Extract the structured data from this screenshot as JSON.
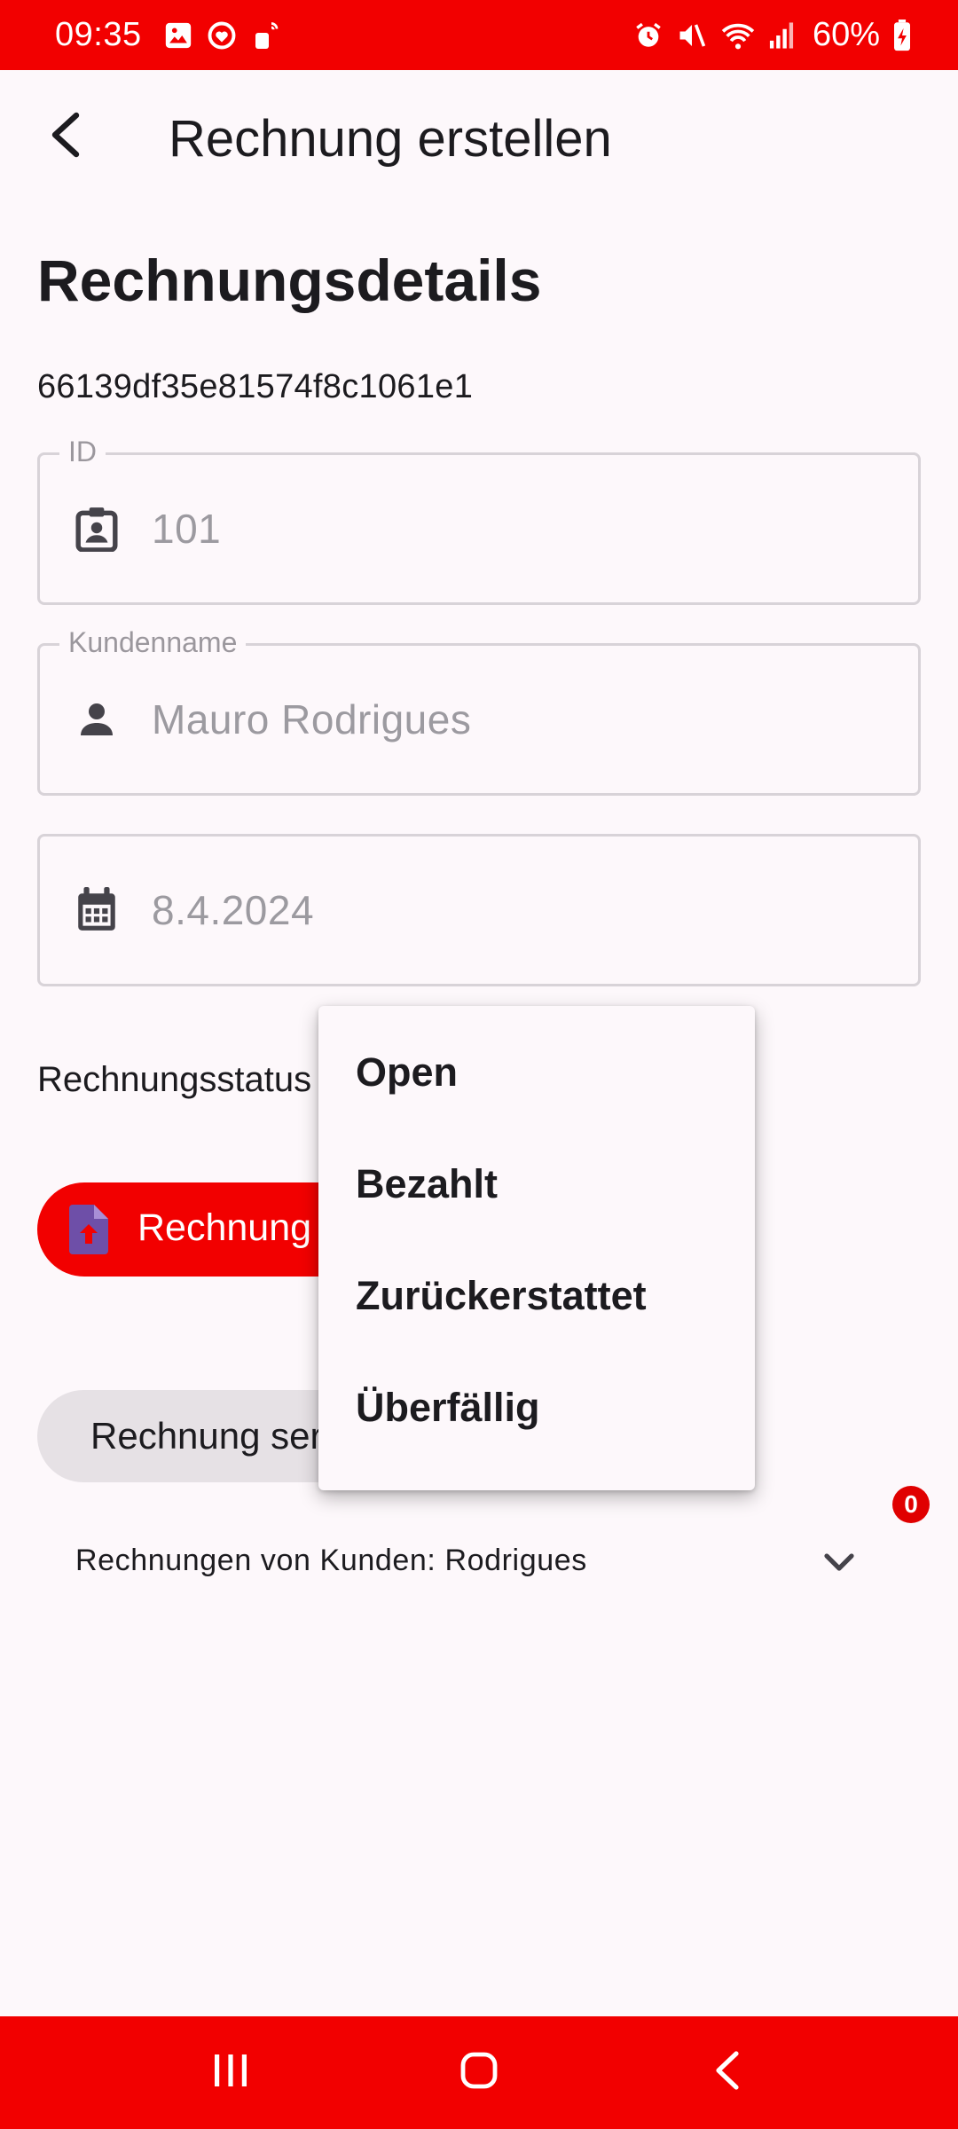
{
  "status_bar": {
    "time": "09:35",
    "battery": "60%",
    "left_icons": [
      "gallery-icon",
      "health-icon",
      "sim-icon"
    ],
    "right_icons": [
      "alarm-icon",
      "mute-icon",
      "wifi-icon",
      "signal-icon",
      "battery-icon"
    ]
  },
  "app_bar": {
    "title": "Rechnung erstellen",
    "back_icon": "back-arrow-icon"
  },
  "section": {
    "title": "Rechnungsdetails",
    "invoice_hash": "66139df35e81574f8c1061e1"
  },
  "fields": {
    "id": {
      "label": "ID",
      "value": "101",
      "icon": "badge-icon"
    },
    "customer": {
      "label": "Kundenname",
      "value": "Mauro Rodrigues",
      "icon": "person-icon"
    },
    "date": {
      "value": "8.4.2024",
      "icon": "calendar-icon"
    }
  },
  "status": {
    "label": "Rechnungsstatus"
  },
  "buttons": {
    "upload_label": "Rechnung a",
    "send_label": "Rechnung ser"
  },
  "dropdown": {
    "options": [
      "Open",
      "Bezahlt",
      "Zurückerstattet",
      "Überfällig"
    ]
  },
  "invoices": {
    "badge_count": "0",
    "title": "Rechnungen von Kunden: Rodrigues"
  },
  "colors": {
    "accent": "#f20000",
    "upload_icon": "#6e4fa8"
  }
}
